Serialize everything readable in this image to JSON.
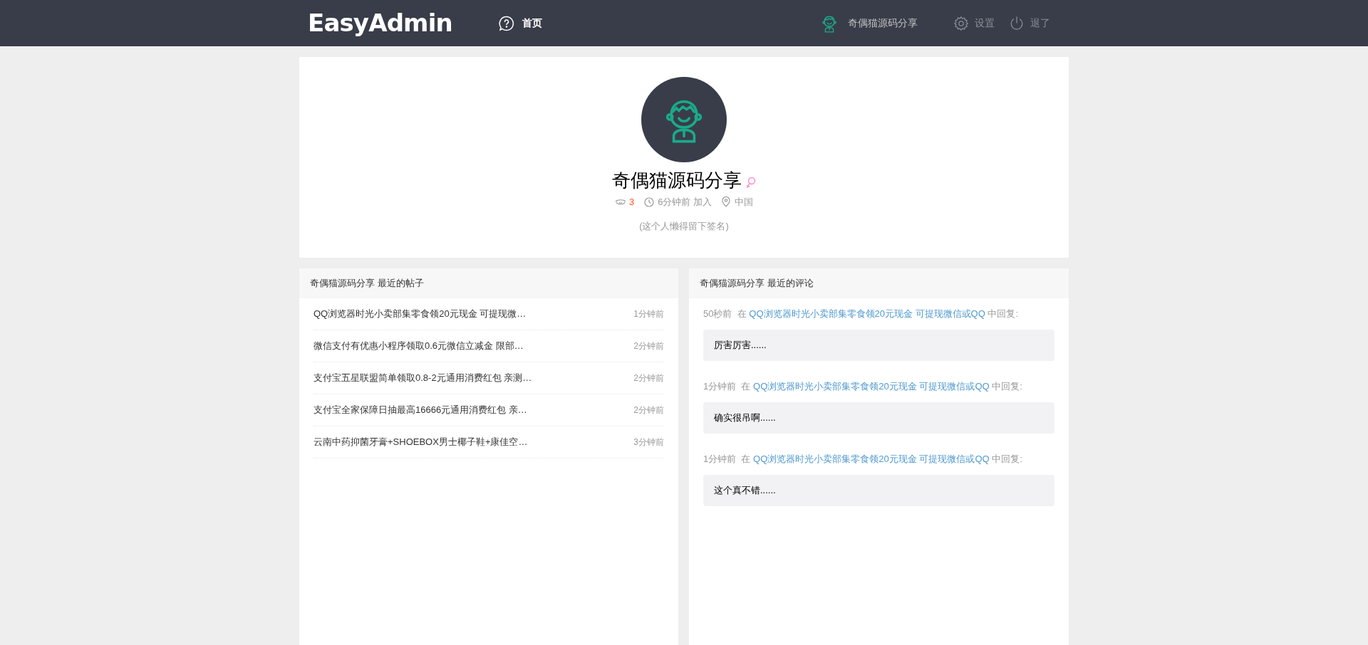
{
  "header": {
    "logo": "EasyAdmin",
    "nav": [
      {
        "label": "首页",
        "selected": true
      }
    ],
    "user": "奇偶猫源码分享",
    "actions": [
      {
        "kind": "settings",
        "label": "设置"
      },
      {
        "kind": "logout",
        "label": "退了"
      }
    ]
  },
  "profile": {
    "name": "奇偶猫源码分享",
    "level": "3",
    "joined": "6分钟前 加入",
    "location": "中国",
    "signature": "(这个人懒得留下签名)"
  },
  "posts": {
    "title": "奇偶猫源码分享 最近的帖子",
    "items": [
      {
        "title": "QQ浏览器时光小卖部集零食领20元现金 可提现微…",
        "time": "1分钟前"
      },
      {
        "title": "微信支付有优惠小程序领取0.6元微信立减金 限部…",
        "time": "2分钟前"
      },
      {
        "title": "支付宝五星联盟简单领取0.8-2元通用消费红包 亲测…",
        "time": "2分钟前"
      },
      {
        "title": "支付宝全家保障日抽最高16666元通用消费红包 亲…",
        "time": "2分钟前"
      },
      {
        "title": "云南中药抑菌牙膏+SHOEBOX男士椰子鞋+康佳空…",
        "time": "3分钟前"
      }
    ]
  },
  "comments": {
    "title": "奇偶猫源码分享 最近的评论",
    "items": [
      {
        "time": "50秒前",
        "prefix": "在",
        "link": "QQ浏览器时光小卖部集零食领20元现金 可提现微信或QQ",
        "suffix": "中回复:",
        "content": "厉害厉害......"
      },
      {
        "time": "1分钟前",
        "prefix": "在",
        "link": "QQ浏览器时光小卖部集零食领20元现金 可提现微信或QQ",
        "suffix": "中回复:",
        "content": "确实很吊啊......"
      },
      {
        "time": "1分钟前",
        "prefix": "在",
        "link": "QQ浏览器时光小卖部集零食领20元现金 可提现微信或QQ",
        "suffix": "中回复:",
        "content": "这个真不错......"
      }
    ]
  }
}
